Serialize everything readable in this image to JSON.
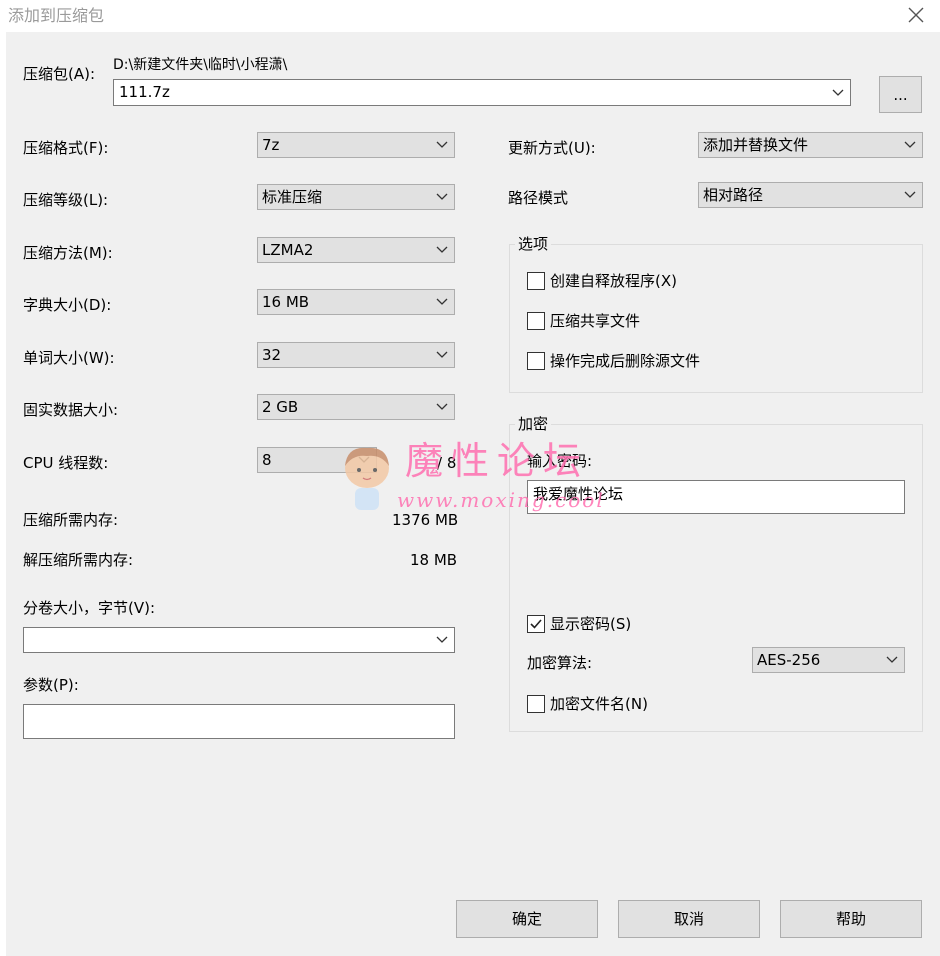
{
  "window": {
    "title": "添加到压缩包"
  },
  "archive": {
    "label": "压缩包(A):",
    "path": "D:\\新建文件夹\\临时\\小程潇\\",
    "name_value": "111.7z",
    "browse_label": "..."
  },
  "left": {
    "format_label": "压缩格式(F):",
    "format_value": "7z",
    "level_label": "压缩等级(L):",
    "level_value": "标准压缩",
    "method_label": "压缩方法(M):",
    "method_value": "LZMA2",
    "dict_label": "字典大小(D):",
    "dict_value": "16 MB",
    "word_label": "单词大小(W):",
    "word_value": "32",
    "solid_label": "固实数据大小:",
    "solid_value": "2 GB",
    "cpu_label": "CPU 线程数:",
    "cpu_value": "8",
    "cpu_max": "/ 8",
    "mem_comp_label": "压缩所需内存:",
    "mem_comp_value": "1376 MB",
    "mem_decomp_label": "解压缩所需内存:",
    "mem_decomp_value": "18 MB",
    "split_label": "分卷大小，字节(V):",
    "split_value": "",
    "params_label": "参数(P):",
    "params_value": ""
  },
  "right": {
    "update_label": "更新方式(U):",
    "update_value": "添加并替换文件",
    "pathmode_label": "路径模式",
    "pathmode_value": "相对路径",
    "options_title": "选项",
    "opt_sfx": "创建自释放程序(X)",
    "opt_shared": "压缩共享文件",
    "opt_delete": "操作完成后删除源文件",
    "enc_title": "加密",
    "password_label": "输入密码:",
    "password_value": "我爱魔性论坛",
    "show_password": "显示密码(S)",
    "show_password_checked": true,
    "method_label": "加密算法:",
    "method_value": "AES-256",
    "encrypt_names": "加密文件名(N)"
  },
  "buttons": {
    "ok": "确定",
    "cancel": "取消",
    "help": "帮助"
  },
  "watermark": {
    "text": "魔性论坛",
    "url": "www.moxing.cool"
  }
}
